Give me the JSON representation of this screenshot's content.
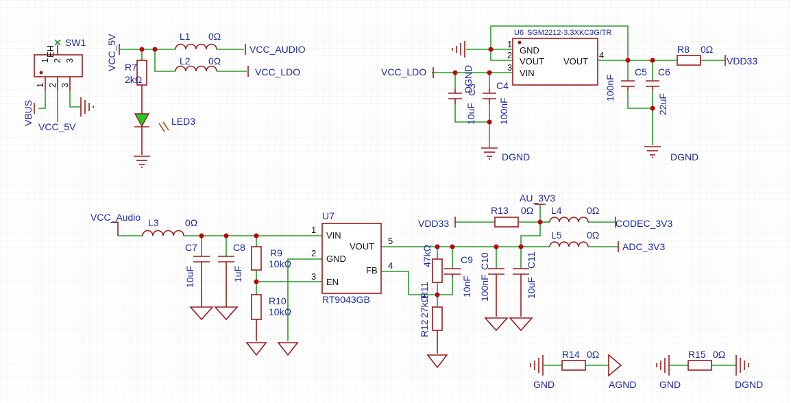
{
  "nets": {
    "vbus": "VBUS",
    "vcc5v_a": "VCC_5V",
    "vcc5v_b": "VCC_5V",
    "vcc_audio": "VCC_AUDIO",
    "vcc_ldo_a": "VCC_LDO",
    "vcc_ldo_b": "VCC_LDO",
    "vdd33_a": "VDD33",
    "vdd33_b": "VDD33",
    "dgnd_a": "DGND",
    "dgnd_b": "DGND",
    "dgnd_c": "DGND",
    "dgnd_d": "DGND",
    "vcc_audio2": "VCC_Audio",
    "au_3v3": "AU_3V3",
    "codec_3v3": "CODEC_3V3",
    "adc_3v3": "ADC_3V3",
    "gnd_a": "GND",
    "gnd_b": "GND",
    "agnd": "AGND"
  },
  "parts": {
    "sw1": {
      "ref": "SW1",
      "body": "EH",
      "pins": [
        "1",
        "2",
        "3",
        "1",
        "2",
        "3"
      ]
    },
    "r7": {
      "ref": "R7",
      "val": "2kΩ"
    },
    "led3": {
      "ref": "LED3"
    },
    "l1": {
      "ref": "L1",
      "val": "0Ω"
    },
    "l2": {
      "ref": "L2",
      "val": "0Ω"
    },
    "u6": {
      "ref": "U6",
      "part": "SGM2212-3.3XKC3G/TR",
      "pins": {
        "p1": "1",
        "p2": "2",
        "p3": "3",
        "p4": "4",
        "gnd": "GND",
        "vout_l": "VOUT",
        "vin": "VIN",
        "vout_r": "VOUT"
      }
    },
    "c3": {
      "ref": "C3",
      "val": "10uF"
    },
    "c4": {
      "ref": "C4",
      "val": "100nF"
    },
    "c5": {
      "ref": "C5",
      "val": "100nF"
    },
    "c6": {
      "ref": "C6",
      "val": "22uF"
    },
    "r8": {
      "ref": "R8",
      "val": "0Ω"
    },
    "l3": {
      "ref": "L3",
      "val": "0Ω"
    },
    "c7": {
      "ref": "C7",
      "val": "10uF"
    },
    "c8": {
      "ref": "C8",
      "val": "1uF"
    },
    "r9": {
      "ref": "R9",
      "val": "10kΩ"
    },
    "r10": {
      "ref": "R10",
      "val": "10kΩ"
    },
    "u7": {
      "ref": "U7",
      "part": "RT9043GB",
      "pins": {
        "p1": "1",
        "p2": "2",
        "p3": "3",
        "p4": "4",
        "p5": "5",
        "vin": "VIN",
        "gnd": "GND",
        "en": "EN",
        "vout": "VOUT",
        "fb": "FB"
      }
    },
    "r11": {
      "ref": "R11",
      "val": "47kΩ"
    },
    "r12": {
      "ref": "R12",
      "val": "27kΩ"
    },
    "c9": {
      "ref": "C9",
      "val": "10nF"
    },
    "c10": {
      "ref": "C10",
      "val": "100nF"
    },
    "c11": {
      "ref": "C11",
      "val": "10uF"
    },
    "r13": {
      "ref": "R13",
      "val": "0Ω"
    },
    "l4": {
      "ref": "L4",
      "val": "0Ω"
    },
    "l5": {
      "ref": "L5",
      "val": "0Ω"
    },
    "r14": {
      "ref": "R14",
      "val": "0Ω"
    },
    "r15": {
      "ref": "R15",
      "val": "0Ω"
    }
  }
}
